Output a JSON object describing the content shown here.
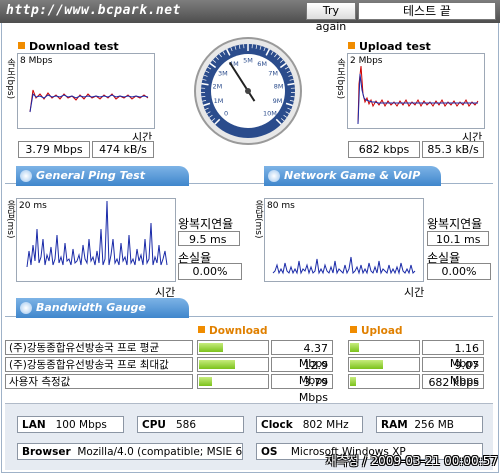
{
  "header": {
    "site": "http://www.bcpark.net",
    "try_again": "Try again",
    "end_test": "테스트 끝"
  },
  "download": {
    "title": "Download test",
    "ylabel": "속도(bps)",
    "scale": "8 Mbps",
    "xlabel": "시간",
    "mbps": "3.79 Mbps",
    "kbs": "474 kB/s"
  },
  "upload": {
    "title": "Upload test",
    "ylabel": "속도(bps)",
    "scale": "2 Mbps",
    "xlabel": "시간",
    "kbps": "682 kbps",
    "kbs": "85.3 kB/s"
  },
  "gauge": {
    "ticks": [
      "0",
      "1M",
      "2M",
      "3M",
      "4M",
      "5M",
      "6M",
      "7M",
      "8M",
      "9M",
      "10M"
    ],
    "value_mbps": 3.79,
    "max_mbps": 10
  },
  "ping_tab": "General Ping Test",
  "game_tab": "Network Game & VoIP Test",
  "ping": {
    "ylabel": "응답(ms)",
    "scale": "20 ms",
    "xlabel": "시간",
    "rtt_label": "왕복지연율",
    "rtt": "9.5 ms",
    "loss_label": "손실율",
    "loss": "0.00%"
  },
  "game": {
    "ylabel": "응답(ms)",
    "scale": "80 ms",
    "xlabel": "시간",
    "rtt_label": "왕복지연율",
    "rtt": "10.1 ms",
    "loss_label": "손실율",
    "loss": "0.00%"
  },
  "bandwidth_tab": "Bandwidth Gauge",
  "bandwidth": {
    "download_head": "Download",
    "upload_head": "Upload",
    "rows": [
      {
        "label": "(주)강동종합유선방송국 프로 평균",
        "down": "4.37 Mbps",
        "down_frac": 0.34,
        "up": "1.16 Mbps",
        "up_frac": 0.13
      },
      {
        "label": "(주)강동종합유선방송국 프로 최대값",
        "down": "12.9 Mbps",
        "down_frac": 0.51,
        "up": "9.07 Mbps",
        "up_frac": 0.47
      },
      {
        "label": "사용자 측정값",
        "down": "3.79 Mbps",
        "down_frac": 0.18,
        "up": "682 kbps",
        "up_frac": 0.08
      }
    ]
  },
  "system": {
    "lan_label": "LAN",
    "lan": "100 Mbps",
    "cpu_label": "CPU",
    "cpu": "586",
    "clock_label": "Clock",
    "clock": "802 MHz",
    "ram_label": "RAM",
    "ram": "256 MB",
    "browser_label": "Browser",
    "browser": "Mozilla/4.0 (compatible; MSIE 6.0",
    "os_label": "OS",
    "os": "Microsoft Windows XP"
  },
  "timestamp": "재측정 / 2009-03-21 00:00:57",
  "colors": {
    "accent": "#f08c00",
    "tab": "#4a8fd4",
    "series_red": "#cc0000",
    "series_blue": "#1a2aa8"
  }
}
